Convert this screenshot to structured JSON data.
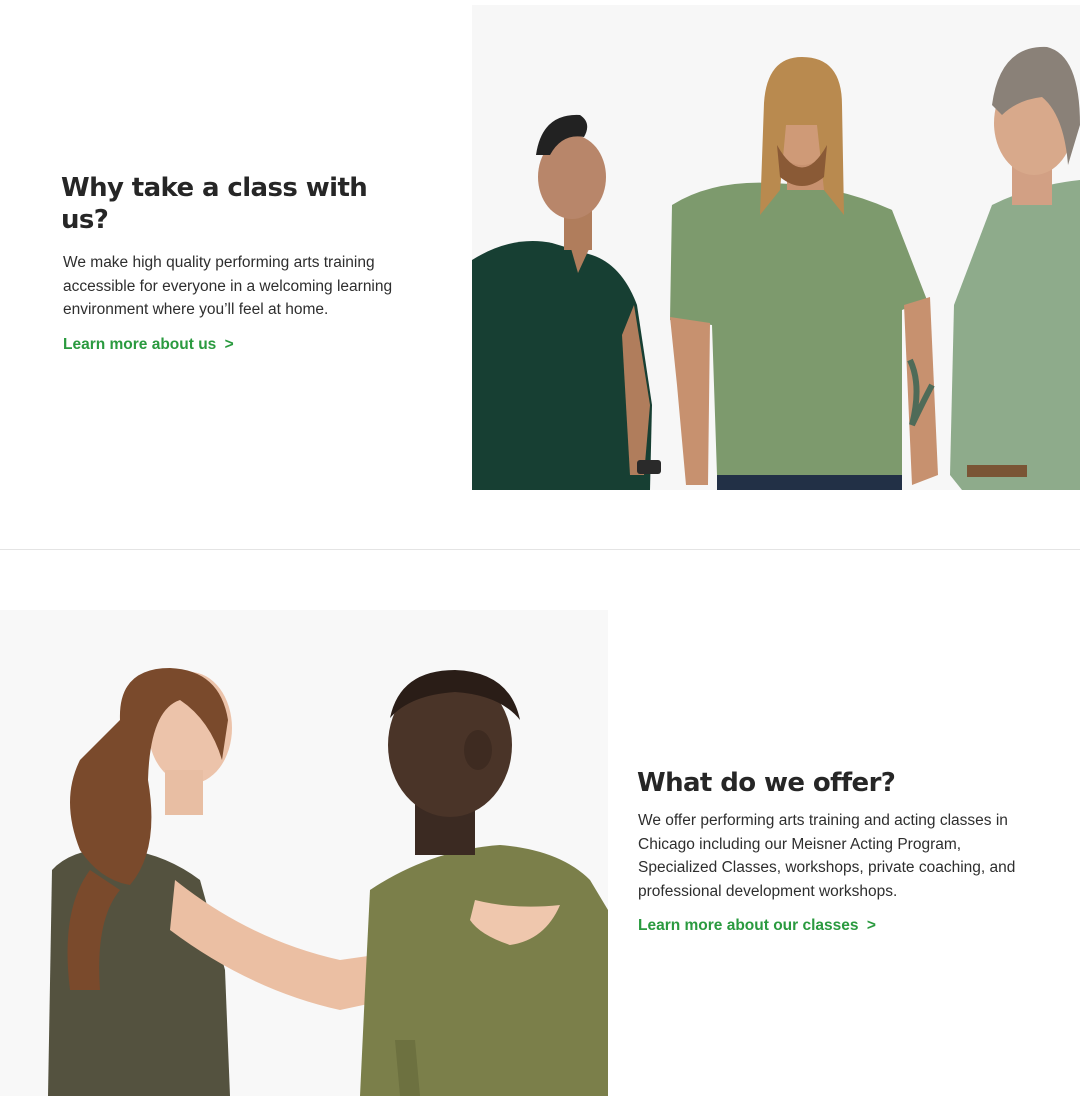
{
  "section_about": {
    "heading": "Why take a class with us?",
    "body": "We make high quality performing arts training accessible for everyone in a welcoming learning environment where you’ll feel at home.",
    "cta_label": "Learn more about us",
    "cta_chevron": ">"
  },
  "section_classes": {
    "heading": "What do we offer?",
    "body": "We offer performing arts training and acting classes in Chicago including our Meisner Acting Program, Specialized Classes, workshops, private coaching, and professional development workshops.",
    "cta_label": "Learn more about our classes",
    "cta_chevron": ">"
  },
  "colors": {
    "accent_green": "#2a9a3f",
    "heading_text": "#262626",
    "divider": "#e4e4e4"
  }
}
